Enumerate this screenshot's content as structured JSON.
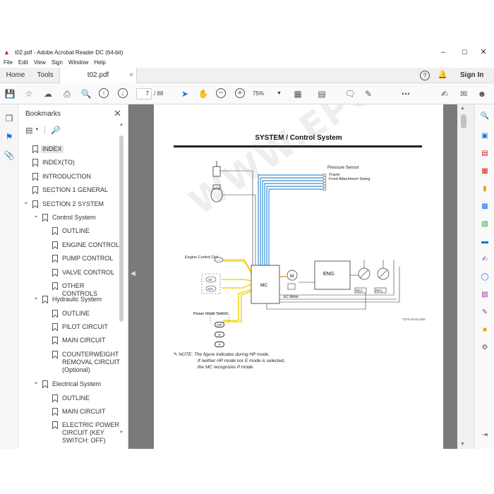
{
  "window": {
    "title": "t02.pdf - Adobe Acrobat Reader DC (64-bit)",
    "minimize": "–",
    "maximize": "☐",
    "close": "✕"
  },
  "menu": [
    "File",
    "Edit",
    "View",
    "Sign",
    "Window",
    "Help"
  ],
  "tabs": {
    "home": "Home",
    "tools": "Tools",
    "document": "t02.pdf",
    "doc_close": "×"
  },
  "header_right": {
    "sign_in": "Sign In"
  },
  "toolbar": {
    "page_current": "7",
    "page_total": "/ 88",
    "zoom": "75%"
  },
  "bookmarks": {
    "title": "Bookmarks",
    "items": [
      {
        "label": "INDEX",
        "level": 0,
        "expand": "",
        "selected": true
      },
      {
        "label": "INDEX(TO)",
        "level": 0,
        "expand": ""
      },
      {
        "label": "INTRODUCTION",
        "level": 0,
        "expand": ""
      },
      {
        "label": "SECTION 1 GENERAL",
        "level": 0,
        "expand": ""
      },
      {
        "label": "SECTION 2 SYSTEM",
        "level": 0,
        "expand": "v"
      },
      {
        "label": "Control System",
        "level": 1,
        "expand": "v"
      },
      {
        "label": "OUTLINE",
        "level": 2,
        "expand": ""
      },
      {
        "label": "ENGINE CONTROL",
        "level": 2,
        "expand": ""
      },
      {
        "label": "PUMP CONTROL",
        "level": 2,
        "expand": ""
      },
      {
        "label": "VALVE CONTROL",
        "level": 2,
        "expand": ""
      },
      {
        "label": "OTHER CONTROLS",
        "level": 2,
        "expand": ""
      },
      {
        "label": "Hydraulic System",
        "level": 1,
        "expand": "v"
      },
      {
        "label": "OUTLINE",
        "level": 2,
        "expand": ""
      },
      {
        "label": "PILOT CIRCUIT",
        "level": 2,
        "expand": ""
      },
      {
        "label": "MAIN CIRCUIT",
        "level": 2,
        "expand": ""
      },
      {
        "label": "COUNTERWEIGHT REMOVAL CIRCUIT (Optional)",
        "level": 2,
        "expand": "",
        "lines": [
          "COUNTERWEIGHT",
          "REMOVAL CIRCUIT",
          "(Optional)"
        ]
      },
      {
        "label": "Electrical System",
        "level": 1,
        "expand": "v"
      },
      {
        "label": "OUTLINE",
        "level": 2,
        "expand": ""
      },
      {
        "label": "MAIN CIRCUIT",
        "level": 2,
        "expand": ""
      },
      {
        "label": "ELECTRIC POWER CIRCUIT (KEY SWITCH: OFF)",
        "level": 2,
        "expand": "",
        "lines": [
          "ELECTRIC POWER",
          "CIRCUIT (KEY",
          "SWITCH: OFF)"
        ]
      }
    ]
  },
  "page": {
    "heading": "SYSTEM / Control System",
    "diagram_labels": {
      "pressure_sensor": "Pressure Sensor",
      "travel": "Travel",
      "front_attachment_swing": "Front Attachment Swing",
      "engine_control_dial": "Engine Control Dial",
      "mc": "MC",
      "eng": "ENG.",
      "ec_motor": "EC Motor",
      "m": "M",
      "reg1": "REG.",
      "reg2": "REG.",
      "a1": "A/I",
      "aa": "A/A",
      "power_mode_switch": "Power Mode Switch",
      "hp": "H/P",
      "e": "E",
      "p": "P"
    },
    "figure_id": "T1F4-02-01-020",
    "note_prefix": "NOTE:",
    "note_lines": [
      "The figure indicates during HP mode.",
      "If neither HP mode nor E mode is selected,",
      "the MC recognizes P mode."
    ],
    "watermark": "WWW.EPCD.COM"
  },
  "colors": {
    "accent": "#1473e6",
    "adobe_red": "#d4241c",
    "wire_blue": "#3a8fd8",
    "wire_yellow": "#f2d51b"
  }
}
